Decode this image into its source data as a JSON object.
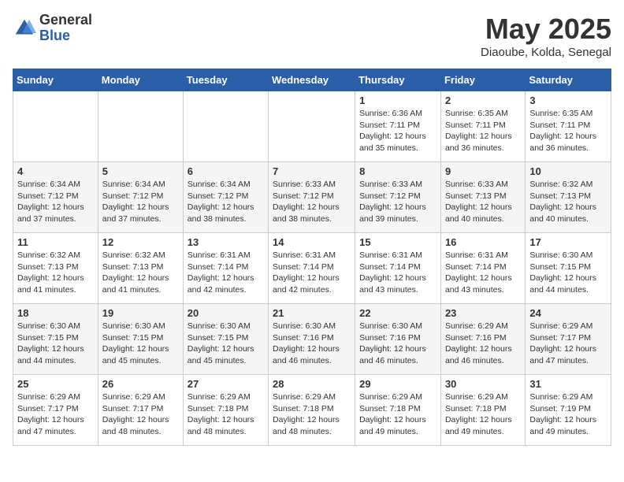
{
  "logo": {
    "general": "General",
    "blue": "Blue"
  },
  "title": "May 2025",
  "location": "Diaoube, Kolda, Senegal",
  "days_of_week": [
    "Sunday",
    "Monday",
    "Tuesday",
    "Wednesday",
    "Thursday",
    "Friday",
    "Saturday"
  ],
  "weeks": [
    [
      {
        "day": "",
        "info": ""
      },
      {
        "day": "",
        "info": ""
      },
      {
        "day": "",
        "info": ""
      },
      {
        "day": "",
        "info": ""
      },
      {
        "day": "1",
        "info": "Sunrise: 6:36 AM\nSunset: 7:11 PM\nDaylight: 12 hours and 35 minutes."
      },
      {
        "day": "2",
        "info": "Sunrise: 6:35 AM\nSunset: 7:11 PM\nDaylight: 12 hours and 36 minutes."
      },
      {
        "day": "3",
        "info": "Sunrise: 6:35 AM\nSunset: 7:11 PM\nDaylight: 12 hours and 36 minutes."
      }
    ],
    [
      {
        "day": "4",
        "info": "Sunrise: 6:34 AM\nSunset: 7:12 PM\nDaylight: 12 hours and 37 minutes."
      },
      {
        "day": "5",
        "info": "Sunrise: 6:34 AM\nSunset: 7:12 PM\nDaylight: 12 hours and 37 minutes."
      },
      {
        "day": "6",
        "info": "Sunrise: 6:34 AM\nSunset: 7:12 PM\nDaylight: 12 hours and 38 minutes."
      },
      {
        "day": "7",
        "info": "Sunrise: 6:33 AM\nSunset: 7:12 PM\nDaylight: 12 hours and 38 minutes."
      },
      {
        "day": "8",
        "info": "Sunrise: 6:33 AM\nSunset: 7:12 PM\nDaylight: 12 hours and 39 minutes."
      },
      {
        "day": "9",
        "info": "Sunrise: 6:33 AM\nSunset: 7:13 PM\nDaylight: 12 hours and 40 minutes."
      },
      {
        "day": "10",
        "info": "Sunrise: 6:32 AM\nSunset: 7:13 PM\nDaylight: 12 hours and 40 minutes."
      }
    ],
    [
      {
        "day": "11",
        "info": "Sunrise: 6:32 AM\nSunset: 7:13 PM\nDaylight: 12 hours and 41 minutes."
      },
      {
        "day": "12",
        "info": "Sunrise: 6:32 AM\nSunset: 7:13 PM\nDaylight: 12 hours and 41 minutes."
      },
      {
        "day": "13",
        "info": "Sunrise: 6:31 AM\nSunset: 7:14 PM\nDaylight: 12 hours and 42 minutes."
      },
      {
        "day": "14",
        "info": "Sunrise: 6:31 AM\nSunset: 7:14 PM\nDaylight: 12 hours and 42 minutes."
      },
      {
        "day": "15",
        "info": "Sunrise: 6:31 AM\nSunset: 7:14 PM\nDaylight: 12 hours and 43 minutes."
      },
      {
        "day": "16",
        "info": "Sunrise: 6:31 AM\nSunset: 7:14 PM\nDaylight: 12 hours and 43 minutes."
      },
      {
        "day": "17",
        "info": "Sunrise: 6:30 AM\nSunset: 7:15 PM\nDaylight: 12 hours and 44 minutes."
      }
    ],
    [
      {
        "day": "18",
        "info": "Sunrise: 6:30 AM\nSunset: 7:15 PM\nDaylight: 12 hours and 44 minutes."
      },
      {
        "day": "19",
        "info": "Sunrise: 6:30 AM\nSunset: 7:15 PM\nDaylight: 12 hours and 45 minutes."
      },
      {
        "day": "20",
        "info": "Sunrise: 6:30 AM\nSunset: 7:15 PM\nDaylight: 12 hours and 45 minutes."
      },
      {
        "day": "21",
        "info": "Sunrise: 6:30 AM\nSunset: 7:16 PM\nDaylight: 12 hours and 46 minutes."
      },
      {
        "day": "22",
        "info": "Sunrise: 6:30 AM\nSunset: 7:16 PM\nDaylight: 12 hours and 46 minutes."
      },
      {
        "day": "23",
        "info": "Sunrise: 6:29 AM\nSunset: 7:16 PM\nDaylight: 12 hours and 46 minutes."
      },
      {
        "day": "24",
        "info": "Sunrise: 6:29 AM\nSunset: 7:17 PM\nDaylight: 12 hours and 47 minutes."
      }
    ],
    [
      {
        "day": "25",
        "info": "Sunrise: 6:29 AM\nSunset: 7:17 PM\nDaylight: 12 hours and 47 minutes."
      },
      {
        "day": "26",
        "info": "Sunrise: 6:29 AM\nSunset: 7:17 PM\nDaylight: 12 hours and 48 minutes."
      },
      {
        "day": "27",
        "info": "Sunrise: 6:29 AM\nSunset: 7:18 PM\nDaylight: 12 hours and 48 minutes."
      },
      {
        "day": "28",
        "info": "Sunrise: 6:29 AM\nSunset: 7:18 PM\nDaylight: 12 hours and 48 minutes."
      },
      {
        "day": "29",
        "info": "Sunrise: 6:29 AM\nSunset: 7:18 PM\nDaylight: 12 hours and 49 minutes."
      },
      {
        "day": "30",
        "info": "Sunrise: 6:29 AM\nSunset: 7:18 PM\nDaylight: 12 hours and 49 minutes."
      },
      {
        "day": "31",
        "info": "Sunrise: 6:29 AM\nSunset: 7:19 PM\nDaylight: 12 hours and 49 minutes."
      }
    ]
  ]
}
